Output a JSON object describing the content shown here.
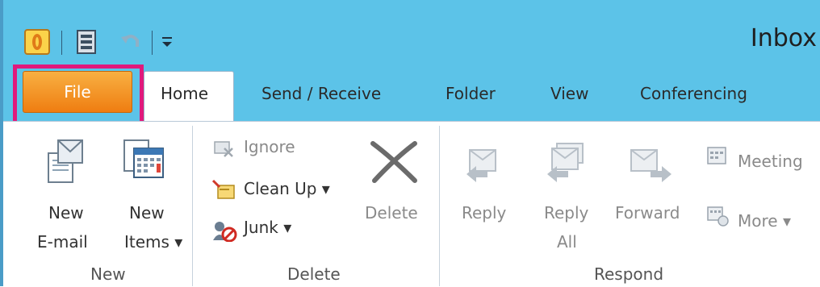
{
  "window": {
    "title": "Inbox"
  },
  "tabs": [
    "Home",
    "Send / Receive",
    "Folder",
    "View",
    "Conferencing"
  ],
  "file_tab": "File",
  "groups": {
    "new": {
      "label": "New",
      "new_email": [
        "New",
        "E-mail"
      ],
      "new_items": [
        "New",
        "Items ▾"
      ]
    },
    "delete": {
      "label": "Delete",
      "ignore": "Ignore",
      "cleanup": "Clean Up ▾",
      "junk": "Junk ▾",
      "delete": "Delete"
    },
    "respond": {
      "label": "Respond",
      "reply": "Reply",
      "reply_all": [
        "Reply",
        "All"
      ],
      "forward": "Forward",
      "meeting": "Meeting",
      "more": "More ▾"
    }
  },
  "colors": {
    "title_bar": "#5cc3e8",
    "file_tab": "#f28a1e",
    "highlight": "#e0197c"
  }
}
